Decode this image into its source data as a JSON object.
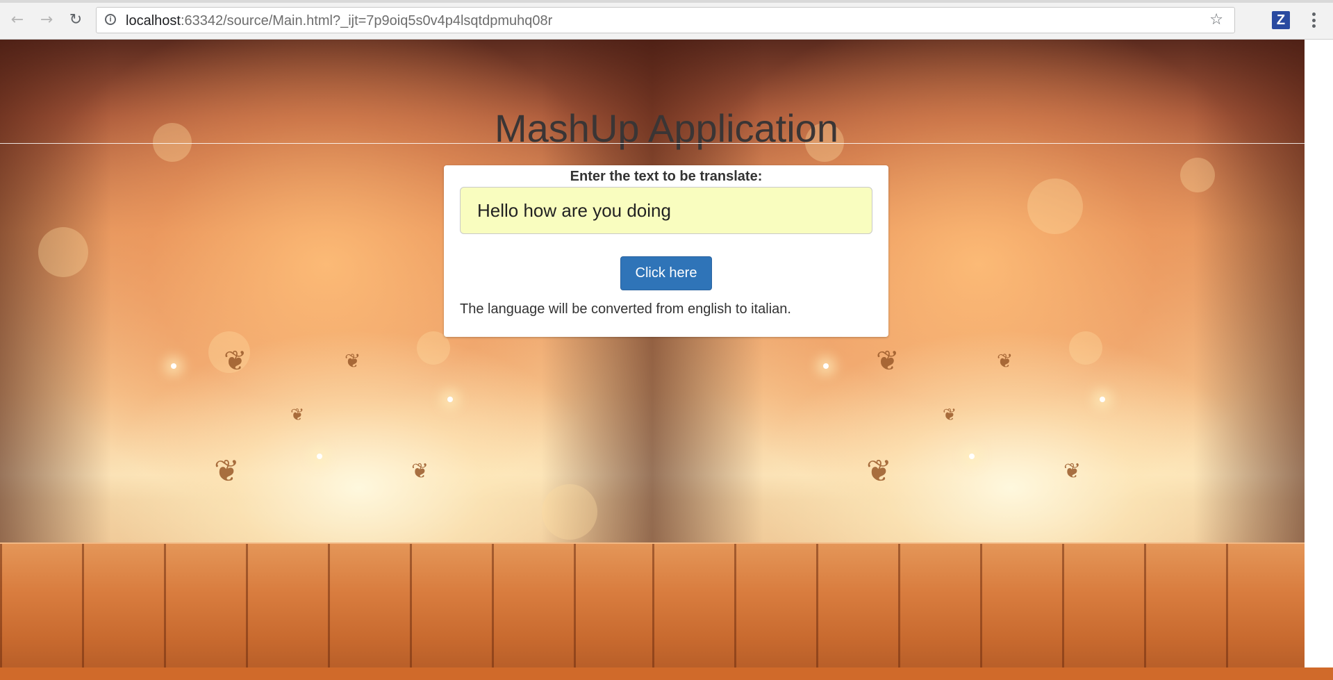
{
  "browser": {
    "url_host": "localhost",
    "url_rest": ":63342/source/Main.html?_ijt=7p9oiq5s0v4p4lsqtdpmuhq08r",
    "extension_label": "Z",
    "icons": {
      "back": "back-arrow-icon",
      "forward": "forward-arrow-icon",
      "reload": "reload-icon",
      "info": "info-icon",
      "star": "star-icon",
      "menu": "kebab-menu-icon"
    }
  },
  "page": {
    "title": "MashUp Application",
    "form": {
      "label": "Enter the text to be translate:",
      "input_value": "Hello how are you doing",
      "button_label": "Click here",
      "note": "The language will be converted from english to italian."
    }
  },
  "colors": {
    "button": "#2f74b8",
    "input_background": "#f9fdbf",
    "title": "#3a3535"
  }
}
